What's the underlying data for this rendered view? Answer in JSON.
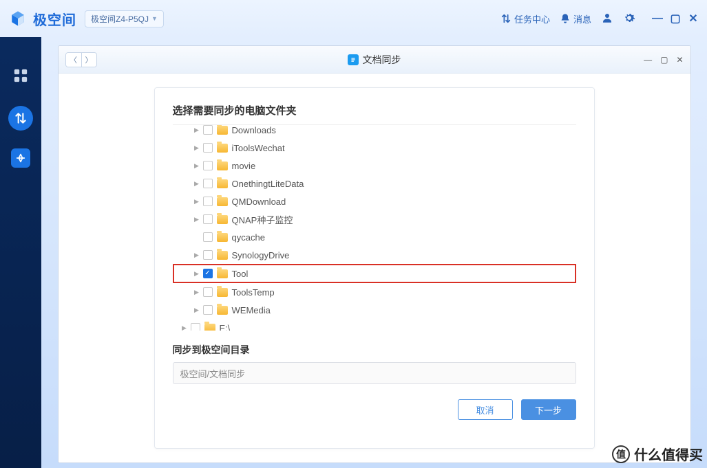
{
  "app": {
    "brand": "极空间",
    "device": "极空间Z4-P5QJ"
  },
  "titlebar": {
    "task_center": "任务中心",
    "messages": "消息"
  },
  "inner_window": {
    "title": "文档同步"
  },
  "dialog": {
    "title": "选择需要同步的电脑文件夹",
    "dest_label": "同步到极空间目录",
    "dest_value": "极空间/文档同步",
    "cancel": "取消",
    "next": "下一步"
  },
  "tree": [
    {
      "level": 2,
      "caret": true,
      "checked": false,
      "label": "Downloads",
      "cutoff": true
    },
    {
      "level": 2,
      "caret": true,
      "checked": false,
      "label": "iToolsWechat"
    },
    {
      "level": 2,
      "caret": true,
      "checked": false,
      "label": "movie"
    },
    {
      "level": 2,
      "caret": true,
      "checked": false,
      "label": "OnethingtLiteData"
    },
    {
      "level": 2,
      "caret": true,
      "checked": false,
      "label": "QMDownload"
    },
    {
      "level": 2,
      "caret": true,
      "checked": false,
      "label": "QNAP种子监控"
    },
    {
      "level": 2,
      "caret": false,
      "checked": false,
      "label": "qycache"
    },
    {
      "level": 2,
      "caret": true,
      "checked": false,
      "label": "SynologyDrive"
    },
    {
      "level": 2,
      "caret": true,
      "checked": true,
      "label": "Tool",
      "highlight": true
    },
    {
      "level": 2,
      "caret": true,
      "checked": false,
      "label": "ToolsTemp"
    },
    {
      "level": 2,
      "caret": true,
      "checked": false,
      "label": "WEMedia"
    },
    {
      "level": 1,
      "caret": true,
      "checked": false,
      "label": "E:\\"
    }
  ],
  "watermark": {
    "circle": "值",
    "text": "什么值得买"
  }
}
